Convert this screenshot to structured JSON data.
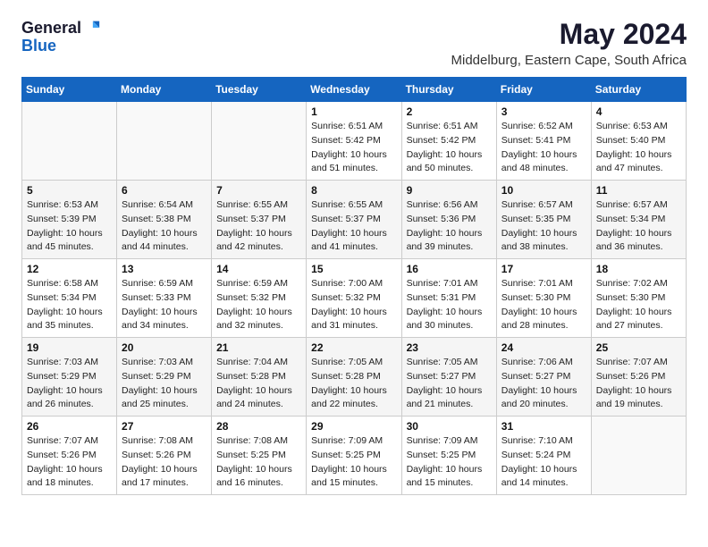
{
  "logo": {
    "general": "General",
    "blue": "Blue"
  },
  "title": "May 2024",
  "subtitle": "Middelburg, Eastern Cape, South Africa",
  "weekdays": [
    "Sunday",
    "Monday",
    "Tuesday",
    "Wednesday",
    "Thursday",
    "Friday",
    "Saturday"
  ],
  "weeks": [
    [
      {
        "day": "",
        "sunrise": "",
        "sunset": "",
        "daylight": ""
      },
      {
        "day": "",
        "sunrise": "",
        "sunset": "",
        "daylight": ""
      },
      {
        "day": "",
        "sunrise": "",
        "sunset": "",
        "daylight": ""
      },
      {
        "day": "1",
        "sunrise": "Sunrise: 6:51 AM",
        "sunset": "Sunset: 5:42 PM",
        "daylight": "Daylight: 10 hours and 51 minutes."
      },
      {
        "day": "2",
        "sunrise": "Sunrise: 6:51 AM",
        "sunset": "Sunset: 5:42 PM",
        "daylight": "Daylight: 10 hours and 50 minutes."
      },
      {
        "day": "3",
        "sunrise": "Sunrise: 6:52 AM",
        "sunset": "Sunset: 5:41 PM",
        "daylight": "Daylight: 10 hours and 48 minutes."
      },
      {
        "day": "4",
        "sunrise": "Sunrise: 6:53 AM",
        "sunset": "Sunset: 5:40 PM",
        "daylight": "Daylight: 10 hours and 47 minutes."
      }
    ],
    [
      {
        "day": "5",
        "sunrise": "Sunrise: 6:53 AM",
        "sunset": "Sunset: 5:39 PM",
        "daylight": "Daylight: 10 hours and 45 minutes."
      },
      {
        "day": "6",
        "sunrise": "Sunrise: 6:54 AM",
        "sunset": "Sunset: 5:38 PM",
        "daylight": "Daylight: 10 hours and 44 minutes."
      },
      {
        "day": "7",
        "sunrise": "Sunrise: 6:55 AM",
        "sunset": "Sunset: 5:37 PM",
        "daylight": "Daylight: 10 hours and 42 minutes."
      },
      {
        "day": "8",
        "sunrise": "Sunrise: 6:55 AM",
        "sunset": "Sunset: 5:37 PM",
        "daylight": "Daylight: 10 hours and 41 minutes."
      },
      {
        "day": "9",
        "sunrise": "Sunrise: 6:56 AM",
        "sunset": "Sunset: 5:36 PM",
        "daylight": "Daylight: 10 hours and 39 minutes."
      },
      {
        "day": "10",
        "sunrise": "Sunrise: 6:57 AM",
        "sunset": "Sunset: 5:35 PM",
        "daylight": "Daylight: 10 hours and 38 minutes."
      },
      {
        "day": "11",
        "sunrise": "Sunrise: 6:57 AM",
        "sunset": "Sunset: 5:34 PM",
        "daylight": "Daylight: 10 hours and 36 minutes."
      }
    ],
    [
      {
        "day": "12",
        "sunrise": "Sunrise: 6:58 AM",
        "sunset": "Sunset: 5:34 PM",
        "daylight": "Daylight: 10 hours and 35 minutes."
      },
      {
        "day": "13",
        "sunrise": "Sunrise: 6:59 AM",
        "sunset": "Sunset: 5:33 PM",
        "daylight": "Daylight: 10 hours and 34 minutes."
      },
      {
        "day": "14",
        "sunrise": "Sunrise: 6:59 AM",
        "sunset": "Sunset: 5:32 PM",
        "daylight": "Daylight: 10 hours and 32 minutes."
      },
      {
        "day": "15",
        "sunrise": "Sunrise: 7:00 AM",
        "sunset": "Sunset: 5:32 PM",
        "daylight": "Daylight: 10 hours and 31 minutes."
      },
      {
        "day": "16",
        "sunrise": "Sunrise: 7:01 AM",
        "sunset": "Sunset: 5:31 PM",
        "daylight": "Daylight: 10 hours and 30 minutes."
      },
      {
        "day": "17",
        "sunrise": "Sunrise: 7:01 AM",
        "sunset": "Sunset: 5:30 PM",
        "daylight": "Daylight: 10 hours and 28 minutes."
      },
      {
        "day": "18",
        "sunrise": "Sunrise: 7:02 AM",
        "sunset": "Sunset: 5:30 PM",
        "daylight": "Daylight: 10 hours and 27 minutes."
      }
    ],
    [
      {
        "day": "19",
        "sunrise": "Sunrise: 7:03 AM",
        "sunset": "Sunset: 5:29 PM",
        "daylight": "Daylight: 10 hours and 26 minutes."
      },
      {
        "day": "20",
        "sunrise": "Sunrise: 7:03 AM",
        "sunset": "Sunset: 5:29 PM",
        "daylight": "Daylight: 10 hours and 25 minutes."
      },
      {
        "day": "21",
        "sunrise": "Sunrise: 7:04 AM",
        "sunset": "Sunset: 5:28 PM",
        "daylight": "Daylight: 10 hours and 24 minutes."
      },
      {
        "day": "22",
        "sunrise": "Sunrise: 7:05 AM",
        "sunset": "Sunset: 5:28 PM",
        "daylight": "Daylight: 10 hours and 22 minutes."
      },
      {
        "day": "23",
        "sunrise": "Sunrise: 7:05 AM",
        "sunset": "Sunset: 5:27 PM",
        "daylight": "Daylight: 10 hours and 21 minutes."
      },
      {
        "day": "24",
        "sunrise": "Sunrise: 7:06 AM",
        "sunset": "Sunset: 5:27 PM",
        "daylight": "Daylight: 10 hours and 20 minutes."
      },
      {
        "day": "25",
        "sunrise": "Sunrise: 7:07 AM",
        "sunset": "Sunset: 5:26 PM",
        "daylight": "Daylight: 10 hours and 19 minutes."
      }
    ],
    [
      {
        "day": "26",
        "sunrise": "Sunrise: 7:07 AM",
        "sunset": "Sunset: 5:26 PM",
        "daylight": "Daylight: 10 hours and 18 minutes."
      },
      {
        "day": "27",
        "sunrise": "Sunrise: 7:08 AM",
        "sunset": "Sunset: 5:26 PM",
        "daylight": "Daylight: 10 hours and 17 minutes."
      },
      {
        "day": "28",
        "sunrise": "Sunrise: 7:08 AM",
        "sunset": "Sunset: 5:25 PM",
        "daylight": "Daylight: 10 hours and 16 minutes."
      },
      {
        "day": "29",
        "sunrise": "Sunrise: 7:09 AM",
        "sunset": "Sunset: 5:25 PM",
        "daylight": "Daylight: 10 hours and 15 minutes."
      },
      {
        "day": "30",
        "sunrise": "Sunrise: 7:09 AM",
        "sunset": "Sunset: 5:25 PM",
        "daylight": "Daylight: 10 hours and 15 minutes."
      },
      {
        "day": "31",
        "sunrise": "Sunrise: 7:10 AM",
        "sunset": "Sunset: 5:24 PM",
        "daylight": "Daylight: 10 hours and 14 minutes."
      },
      {
        "day": "",
        "sunrise": "",
        "sunset": "",
        "daylight": ""
      }
    ]
  ]
}
